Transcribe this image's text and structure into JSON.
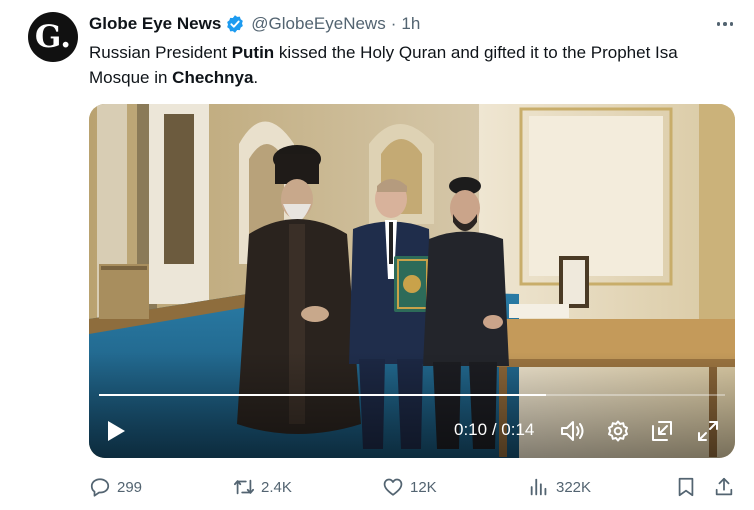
{
  "author": {
    "avatar_letter": "G.",
    "name": "Globe Eye News",
    "handle": "@GlobeEyeNews",
    "separator": "·",
    "time": "1h",
    "verified_color": "#1d9bf0"
  },
  "post": {
    "text_1": "Russian President ",
    "bold_1": "Putin",
    "text_2": " kissed the Holy Quran and gifted it to the Prophet Isa Mosque in ",
    "bold_2": "Chechnya",
    "text_3": "."
  },
  "video": {
    "elapsed": "0:10",
    "separator": " / ",
    "duration": "0:14",
    "progress_fraction": 0.714,
    "icons": [
      "play-icon",
      "volume-icon",
      "settings-icon",
      "picture-in-picture-icon",
      "fullscreen-icon"
    ]
  },
  "actions": {
    "replies": "299",
    "reposts": "2.4K",
    "likes": "12K",
    "views": "322K",
    "icons": [
      "reply-icon",
      "repost-icon",
      "like-icon",
      "views-icon",
      "bookmark-icon",
      "share-icon"
    ]
  },
  "colors": {
    "text_primary": "#0f1419",
    "text_secondary": "#536471",
    "accent": "#1d9bf0"
  }
}
